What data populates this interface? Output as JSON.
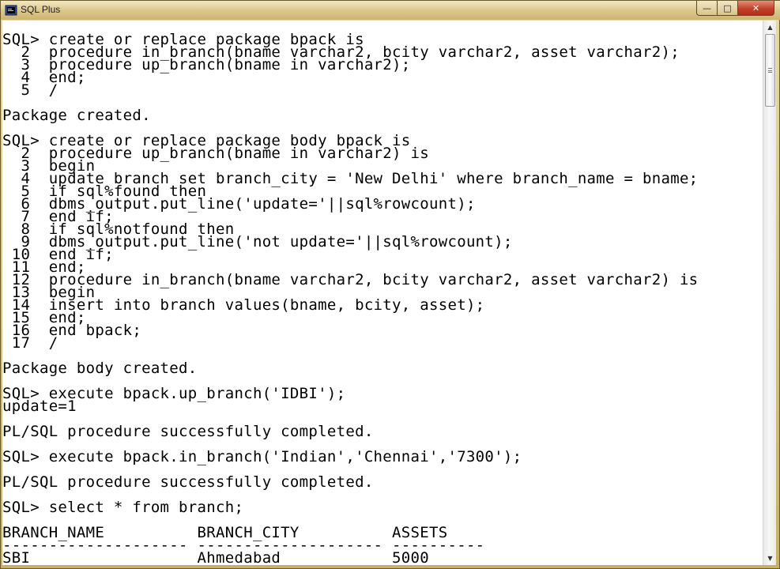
{
  "window": {
    "title": "SQL Plus",
    "controls": {
      "minimize": "—",
      "maximize": "□",
      "close": "✕"
    }
  },
  "console": {
    "lines": [
      "SQL> create or replace package bpack is",
      "  2  procedure in_branch(bname varchar2, bcity varchar2, asset varchar2);",
      "  3  procedure up_branch(bname in varchar2);",
      "  4  end;",
      "  5  /",
      "",
      "Package created.",
      "",
      "SQL> create or replace package body bpack is",
      "  2  procedure up_branch(bname in varchar2) is",
      "  3  begin",
      "  4  update branch set branch_city = 'New Delhi' where branch_name = bname;",
      "  5  if sql%found then",
      "  6  dbms_output.put_line('update='||sql%rowcount);",
      "  7  end if;",
      "  8  if sql%notfound then",
      "  9  dbms_output.put_line('not update='||sql%rowcount);",
      " 10  end if;",
      " 11  end;",
      " 12  procedure in_branch(bname varchar2, bcity varchar2, asset varchar2) is",
      " 13  begin",
      " 14  insert into branch values(bname, bcity, asset);",
      " 15  end;",
      " 16  end bpack;",
      " 17  /",
      "",
      "Package body created.",
      "",
      "SQL> execute bpack.up_branch('IDBI');",
      "update=1",
      "",
      "PL/SQL procedure successfully completed.",
      "",
      "SQL> execute bpack.in_branch('Indian','Chennai','7300');",
      "",
      "PL/SQL procedure successfully completed.",
      "",
      "SQL> select * from branch;",
      "",
      "BRANCH_NAME          BRANCH_CITY          ASSETS",
      "-------------------- -------------------- ----------",
      "SBI                  Ahmedabad            5000"
    ]
  },
  "icons": {
    "app": "sql-plus-icon",
    "scroll_up": "scroll-up-arrow-icon",
    "scroll_down": "scroll-down-arrow-icon"
  },
  "colors": {
    "title_bar": "#dcc88d",
    "console_background": "#ffffff",
    "console_text": "#000000",
    "close_button": "#c3412a"
  }
}
